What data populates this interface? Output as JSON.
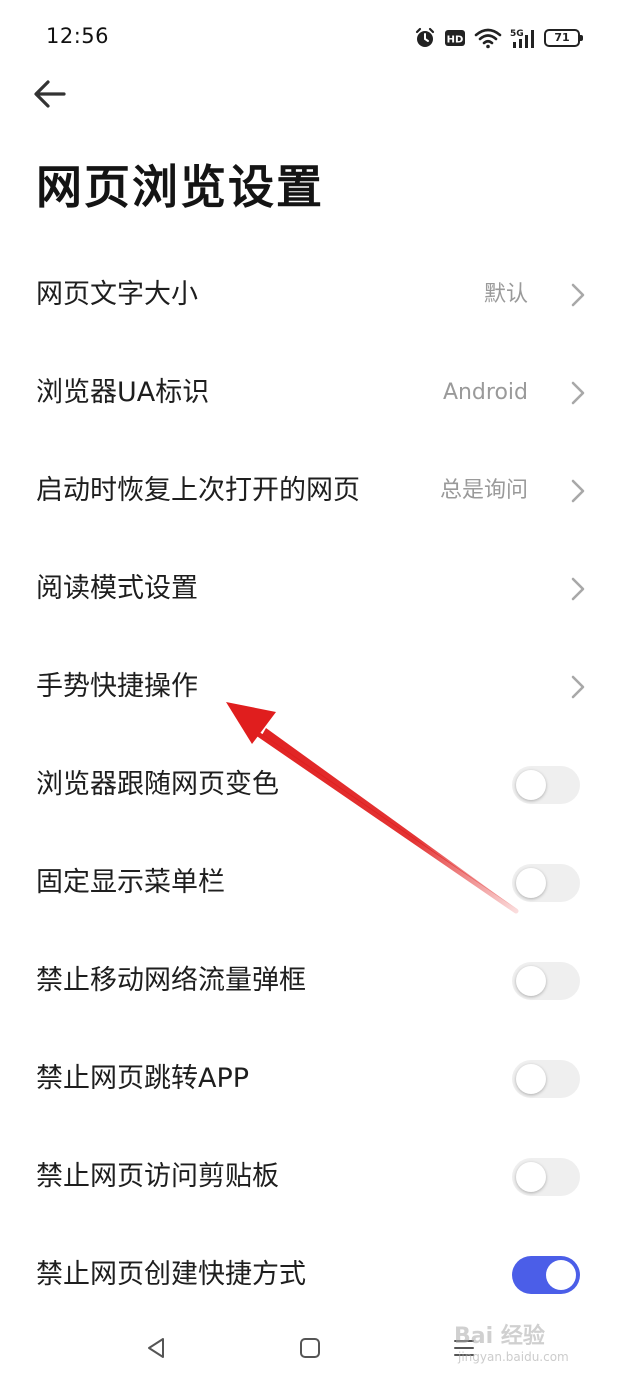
{
  "status_bar": {
    "time": "12:56",
    "network": "5G",
    "hd": "HD",
    "battery": "71",
    "icons": [
      "alarm-icon",
      "hd-icon",
      "wifi-icon",
      "signal-5g-icon",
      "battery-icon"
    ]
  },
  "header": {
    "back_icon": "arrow-left-icon",
    "title": "网页浏览设置"
  },
  "settings": {
    "items": [
      {
        "label": "网页文字大小",
        "value": "默认",
        "type": "link"
      },
      {
        "label": "浏览器UA标识",
        "value": "Android",
        "type": "link"
      },
      {
        "label": "启动时恢复上次打开的网页",
        "value": "总是询问",
        "type": "link"
      },
      {
        "label": "阅读模式设置",
        "value": "",
        "type": "link"
      },
      {
        "label": "手势快捷操作",
        "value": "",
        "type": "link"
      },
      {
        "label": "浏览器跟随网页变色",
        "type": "toggle",
        "on": false
      },
      {
        "label": "固定显示菜单栏",
        "type": "toggle",
        "on": false
      },
      {
        "label": "禁止移动网络流量弹框",
        "type": "toggle",
        "on": false
      },
      {
        "label": "禁止网页跳转APP",
        "type": "toggle",
        "on": false
      },
      {
        "label": "禁止网页访问剪贴板",
        "type": "toggle",
        "on": false
      },
      {
        "label": "禁止网页创建快捷方式",
        "type": "toggle",
        "on": true
      }
    ]
  },
  "nav_bar": {
    "icons": [
      "nav-back-icon",
      "nav-home-icon",
      "nav-menu-icon"
    ]
  },
  "watermark": {
    "text": "Bai 经验",
    "sub": "jingyan.baidu.com"
  },
  "colors": {
    "accent": "#4b5ee8",
    "toggle_off": "#efefef",
    "annotation_arrow": "#e01e1e",
    "secondary_text": "#9a9a9a"
  }
}
